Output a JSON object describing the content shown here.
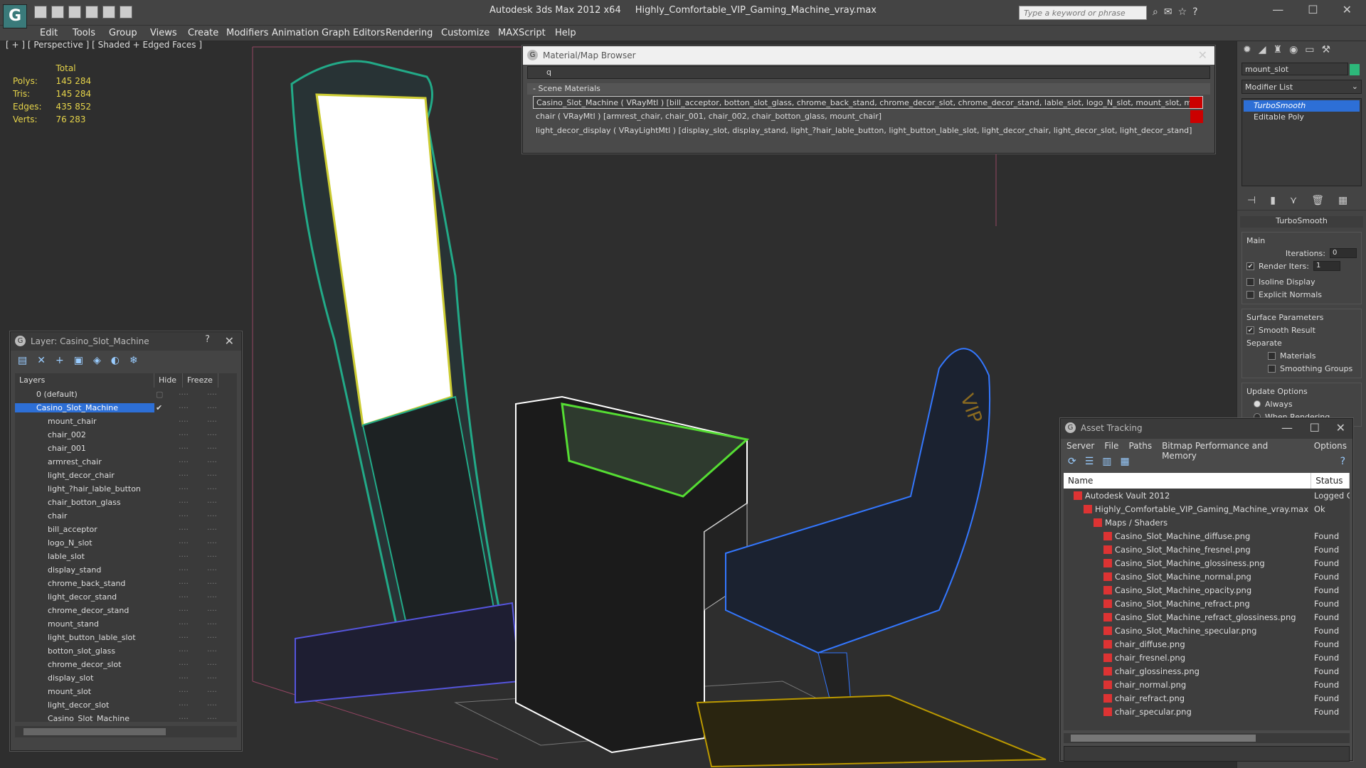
{
  "app": {
    "title": "Autodesk 3ds Max  2012 x64",
    "file": "Highly_Comfortable_VIP_Gaming_Machine_vray.max",
    "search_placeholder": "Type a keyword or phrase"
  },
  "menu": [
    "Edit",
    "Tools",
    "Group",
    "Views",
    "Create",
    "Modifiers",
    "Animation",
    "Graph Editors",
    "Rendering",
    "Customize",
    "MAXScript",
    "Help"
  ],
  "viewport": {
    "label": "[ + ] [ Perspective ] [ Shaded + Edged Faces ]",
    "stats": {
      "header": "Total",
      "rows": [
        {
          "label": "Polys:",
          "value": "145 284"
        },
        {
          "label": "Tris:",
          "value": "145 284"
        },
        {
          "label": "Edges:",
          "value": "435 852"
        },
        {
          "label": "Verts:",
          "value": "76 283"
        }
      ]
    }
  },
  "material_browser": {
    "title": "Material/Map Browser",
    "search_value": "q",
    "group": "- Scene Materials",
    "rows": [
      "Casino_Slot_Machine ( VRayMtl ) [bill_acceptor, botton_slot_glass, chrome_back_stand, chrome_decor_slot, chrome_decor_stand, lable_slot, logo_N_slot, mount_slot, mount_stand]",
      "chair  ( VRayMtl ) [armrest_chair, chair_001, chair_002, chair_botton_glass, mount_chair]",
      "light_decor_display ( VRayLightMtl ) [display_slot, display_stand, light_?hair_lable_button, light_button_lable_slot, light_decor_chair, light_decor_slot, light_decor_stand]"
    ]
  },
  "layer_dialog": {
    "title": "Layer: Casino_Slot_Machine",
    "help": "?",
    "col_layers": "Layers",
    "col_hide": "Hide",
    "col_freeze": "Freeze",
    "top": [
      "0 (default)",
      "Casino_Slot_Machine"
    ],
    "items": [
      "mount_chair",
      "chair_002",
      "chair_001",
      "armrest_chair",
      "light_decor_chair",
      "light_?hair_lable_button",
      "chair_botton_glass",
      "chair",
      "bill_acceptor",
      "logo_N_slot",
      "lable_slot",
      "display_stand",
      "chrome_back_stand",
      "light_decor_stand",
      "chrome_decor_stand",
      "mount_stand",
      "light_button_lable_slot",
      "botton_slot_glass",
      "chrome_decor_slot",
      "display_slot",
      "mount_slot",
      "light_decor_slot",
      "Casino_Slot_Machine"
    ]
  },
  "command_panel": {
    "object_name": "mount_slot",
    "modifier_list": "Modifier List",
    "stack": [
      "TurboSmooth",
      "Editable Poly"
    ],
    "rollout_title": "TurboSmooth",
    "main_label": "Main",
    "iterations_label": "Iterations:",
    "iterations_value": "0",
    "render_iters_label": "Render Iters:",
    "render_iters_value": "1",
    "isoline": "Isoline Display",
    "explicit": "Explicit Normals",
    "surface_label": "Surface Parameters",
    "smooth_result": "Smooth Result",
    "separate_label": "Separate",
    "materials": "Materials",
    "smoothing_groups": "Smoothing Groups",
    "update_label": "Update Options",
    "always": "Always",
    "when_rendering": "When Rendering"
  },
  "asset_tracking": {
    "title": "Asset Tracking",
    "menu": [
      "Server",
      "File",
      "Paths",
      "Bitmap Performance and Memory",
      "Options"
    ],
    "col_name": "Name",
    "col_status": "Status",
    "rows": [
      {
        "name": "Autodesk Vault 2012",
        "status": "Logged Ou",
        "indent": 1
      },
      {
        "name": "Highly_Comfortable_VIP_Gaming_Machine_vray.max",
        "status": "Ok",
        "indent": 2
      },
      {
        "name": "Maps / Shaders",
        "status": "",
        "indent": 3
      },
      {
        "name": "Casino_Slot_Machine_diffuse.png",
        "status": "Found",
        "indent": 4
      },
      {
        "name": "Casino_Slot_Machine_fresnel.png",
        "status": "Found",
        "indent": 4
      },
      {
        "name": "Casino_Slot_Machine_glossiness.png",
        "status": "Found",
        "indent": 4
      },
      {
        "name": "Casino_Slot_Machine_normal.png",
        "status": "Found",
        "indent": 4
      },
      {
        "name": "Casino_Slot_Machine_opacity.png",
        "status": "Found",
        "indent": 4
      },
      {
        "name": "Casino_Slot_Machine_refract.png",
        "status": "Found",
        "indent": 4
      },
      {
        "name": "Casino_Slot_Machine_refract_glossiness.png",
        "status": "Found",
        "indent": 4
      },
      {
        "name": "Casino_Slot_Machine_specular.png",
        "status": "Found",
        "indent": 4
      },
      {
        "name": "chair_diffuse.png",
        "status": "Found",
        "indent": 4
      },
      {
        "name": "chair_fresnel.png",
        "status": "Found",
        "indent": 4
      },
      {
        "name": "chair_glossiness.png",
        "status": "Found",
        "indent": 4
      },
      {
        "name": "chair_normal.png",
        "status": "Found",
        "indent": 4
      },
      {
        "name": "chair_refract.png",
        "status": "Found",
        "indent": 4
      },
      {
        "name": "chair_specular.png",
        "status": "Found",
        "indent": 4
      }
    ]
  }
}
